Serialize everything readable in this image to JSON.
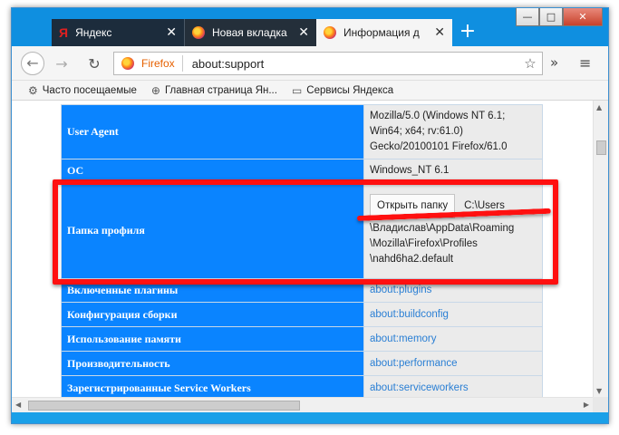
{
  "window_controls": {
    "minimize": "—",
    "maximize": "□",
    "close": "✕"
  },
  "tabs": [
    {
      "label": "Яндекс",
      "favicon": "Я",
      "close": "✕"
    },
    {
      "label": "Новая вкладка",
      "close": "✕"
    },
    {
      "label": "Информация д",
      "close": "✕"
    }
  ],
  "new_tab": "+",
  "nav": {
    "back": "←",
    "forward": "→",
    "reload": "↻",
    "identity_label": "Firefox",
    "url": "about:support",
    "bookmark_star": "☆",
    "overflow": "»",
    "menu": "≡"
  },
  "bookmarks": [
    {
      "icon": "gear-icon",
      "glyph": "⚙",
      "label": "Часто посещаемые"
    },
    {
      "icon": "globe-icon",
      "glyph": "⊕",
      "label": "Главная страница Ян..."
    },
    {
      "icon": "folder-icon",
      "glyph": "▭",
      "label": "Сервисы Яндекса"
    }
  ],
  "table": {
    "user_agent_key": "User Agent",
    "user_agent_lines": [
      "Mozilla/5.0 (Windows NT 6.1;",
      "Win64; x64; rv:61.0)",
      "Gecko/20100101 Firefox/61.0"
    ],
    "os_key": "ОС",
    "os_value": "Windows_NT 6.1",
    "profile_key": "Папка профиля",
    "open_folder_button": "Открыть папку",
    "profile_lines": [
      "C:\\Users",
      "\\Владислав\\AppData\\Roaming",
      "\\Mozilla\\Firefox\\Profiles",
      "\\nahd6ha2.default"
    ],
    "plugins_key": "Включенные плагины",
    "plugins_link": "about:plugins",
    "build_key": "Конфигурация сборки",
    "build_link": "about:buildconfig",
    "memory_key": "Использование памяти",
    "memory_link": "about:memory",
    "perf_key": "Производительность",
    "perf_link": "about:performance",
    "sw_key": "Зарегистрированные Service Workers",
    "sw_link": "about:serviceworkers"
  },
  "colors": {
    "accent_blue": "#0a84ff",
    "highlight_red": "#ff1010",
    "link_blue": "#2a7fd4"
  }
}
